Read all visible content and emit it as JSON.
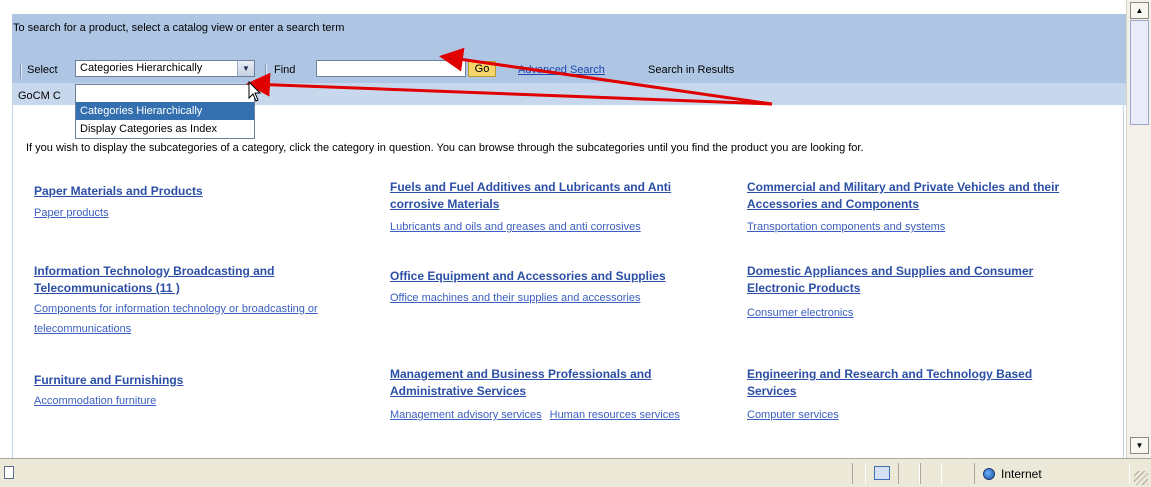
{
  "search": {
    "instruction": "To search for a product, select a catalog view or enter a search term",
    "select_label": "Select",
    "select_value": "Categories Hierarchically",
    "find_label": "Find",
    "find_value": "",
    "go_label": "Go",
    "advanced_search": "Advanced Search",
    "search_in_results": "Search in Results"
  },
  "breadcrumb": "GoCM C",
  "dropdown": {
    "options": [
      "",
      "Categories Hierarchically",
      "Display Categories as Index"
    ],
    "highlighted": "Categories Hierarchically"
  },
  "help_text": "If you wish to display the subcategories of a category, click the category in question. You can browse through the subcategories until you find the product you are looking for.",
  "categories": [
    {
      "title_lines": [
        "Paper Materials and Products"
      ],
      "subs": [
        "Paper products"
      ]
    },
    {
      "title_lines": [
        "Fuels and Fuel Additives and Lubricants and Anti",
        "corrosive Materials"
      ],
      "subs": [
        "Lubricants and oils and greases and anti corrosives"
      ]
    },
    {
      "title_lines": [
        "Commercial and Military and Private Vehicles and their",
        "Accessories and Components"
      ],
      "subs": [
        "Transportation components and systems"
      ]
    },
    {
      "title_lines": [
        "Information Technology Broadcasting and",
        "Telecommunications (11 )"
      ],
      "subs": [
        "Components for information technology or broadcasting or",
        "telecommunications"
      ]
    },
    {
      "title_lines": [
        "Office Equipment and Accessories and Supplies"
      ],
      "subs": [
        "Office machines and their supplies and accessories"
      ]
    },
    {
      "title_lines": [
        "Domestic Appliances and Supplies and Consumer",
        "Electronic Products"
      ],
      "subs": [
        "Consumer electronics"
      ]
    },
    {
      "title_lines": [
        "Furniture and Furnishings"
      ],
      "subs": [
        "Accommodation furniture"
      ]
    },
    {
      "title_lines": [
        "Management and Business Professionals and",
        "Administrative Services"
      ],
      "subs": [
        "Management advisory services",
        "Human resources services"
      ]
    },
    {
      "title_lines": [
        "Engineering and Research and Technology Based",
        "Services"
      ],
      "subs": [
        "Computer services"
      ]
    }
  ],
  "status": {
    "zone": "Internet"
  },
  "icons": {
    "select_arrow": "dropdown-arrow-icon",
    "scroll_up": "scroll-up-arrow-icon",
    "scroll_down": "scroll-down-arrow-icon",
    "status_document": "document-icon",
    "status_page": "page-icon",
    "status_zone": "globe-icon",
    "annotation": "red-arrow-icon"
  },
  "colors": {
    "search_panel": "#aec6e4",
    "breadcrumb_bar": "#c7d8ec",
    "link": "#2c4fa6",
    "go_button": "#f4d56a",
    "dropdown_highlight": "#3470b0",
    "annotation_arrow": "#e00000"
  }
}
